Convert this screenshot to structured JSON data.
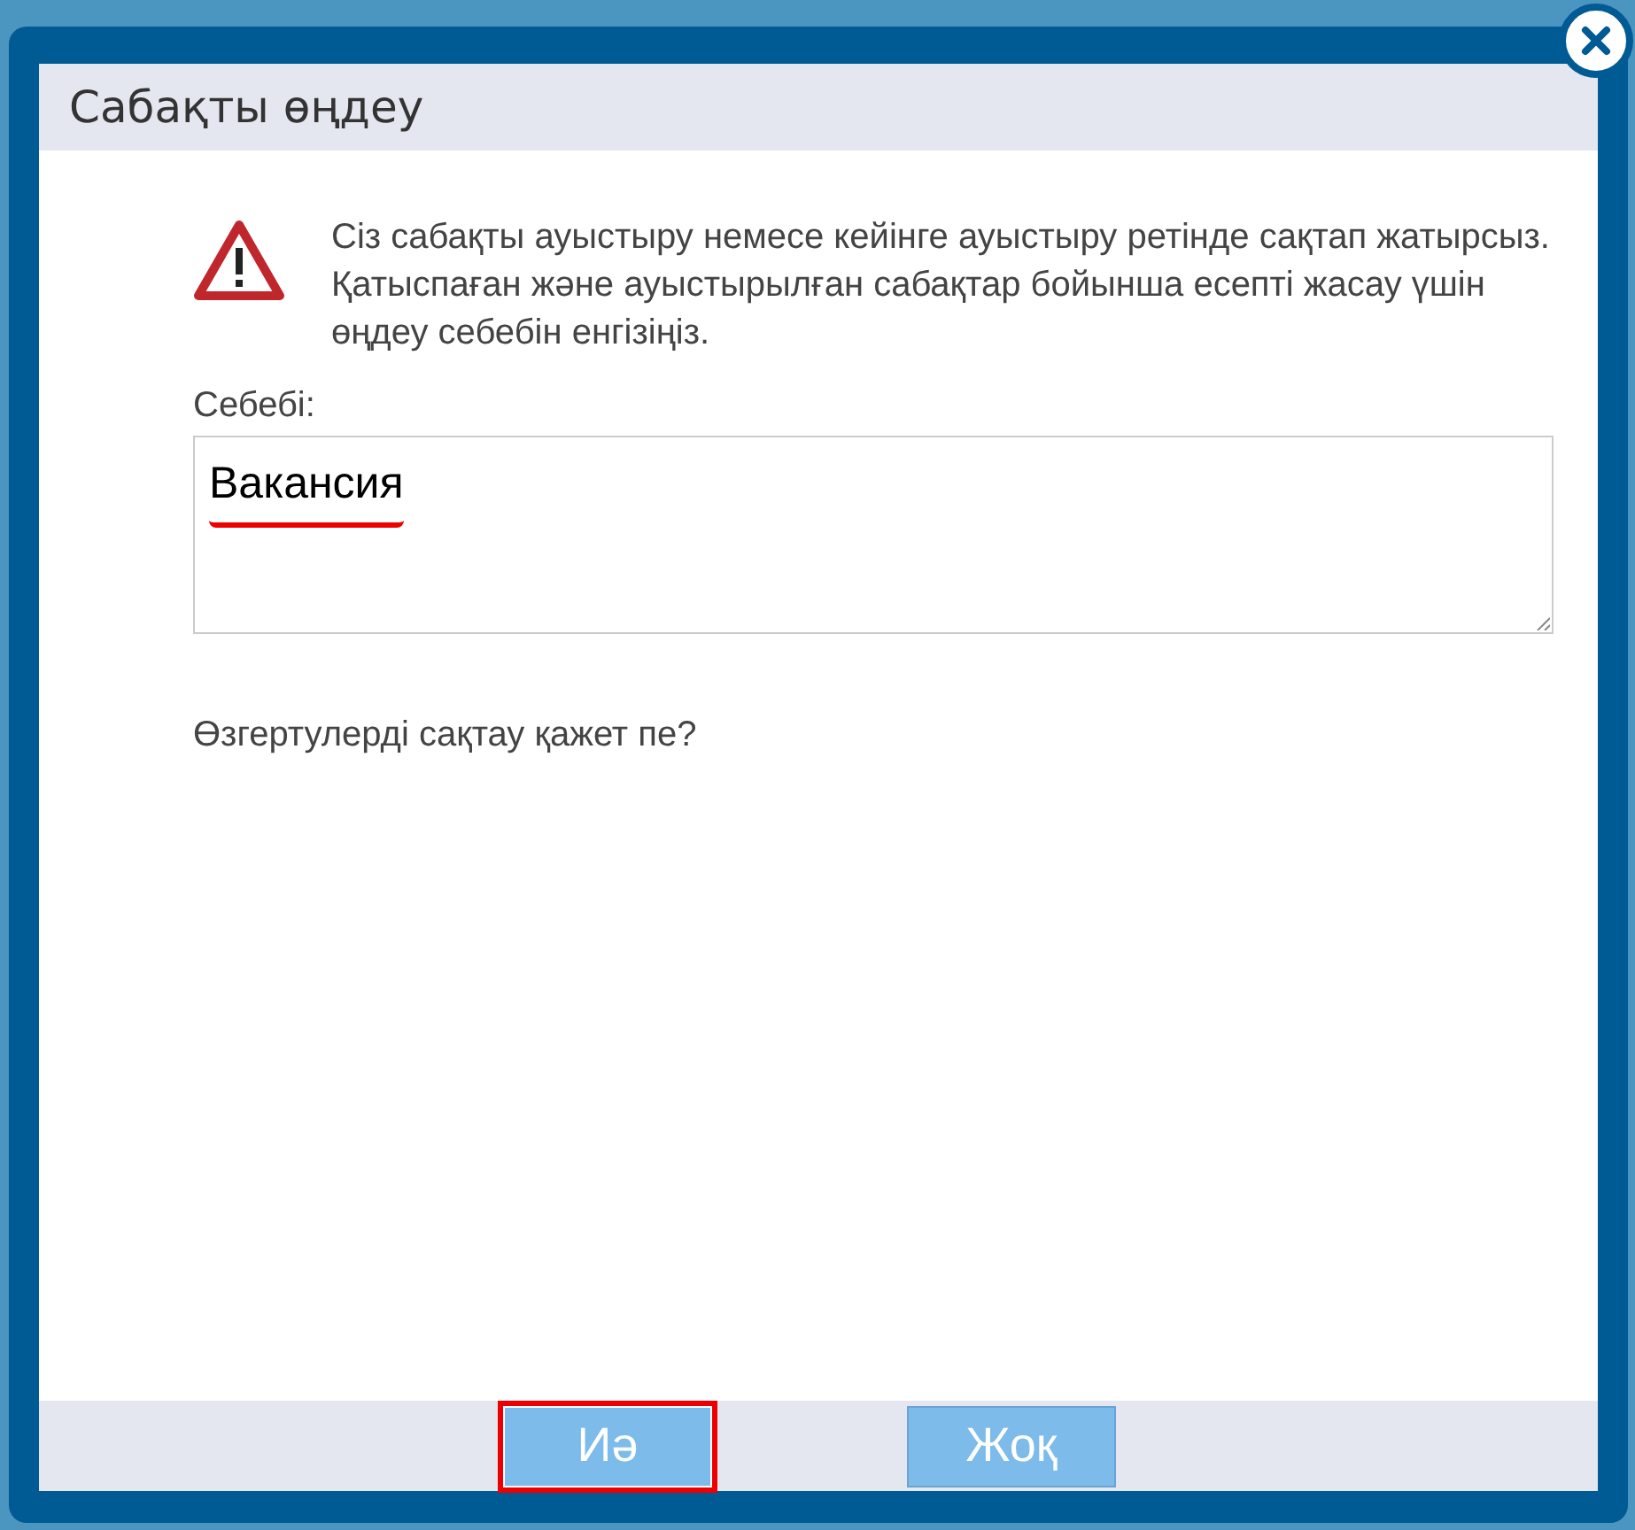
{
  "dialog": {
    "title": "Сабақты өңдеу",
    "message": "Сіз сабақты ауыстыру немесе кейінге ауыстыру ретінде сақтап жатырсыз. Қатыспаған және ауыстырылған сабақтар бойынша есепті жасау үшін өңдеу себебін енгізіңіз.",
    "reason_label": "Себебі:",
    "reason": {
      "value": "Вакансия",
      "misspelled": true
    },
    "question": "Өзгертулерді сақтау қажет пе?",
    "buttons": [
      {
        "label": "Иә",
        "highlighted": true
      },
      {
        "label": "Жоқ",
        "highlighted": false
      }
    ]
  }
}
